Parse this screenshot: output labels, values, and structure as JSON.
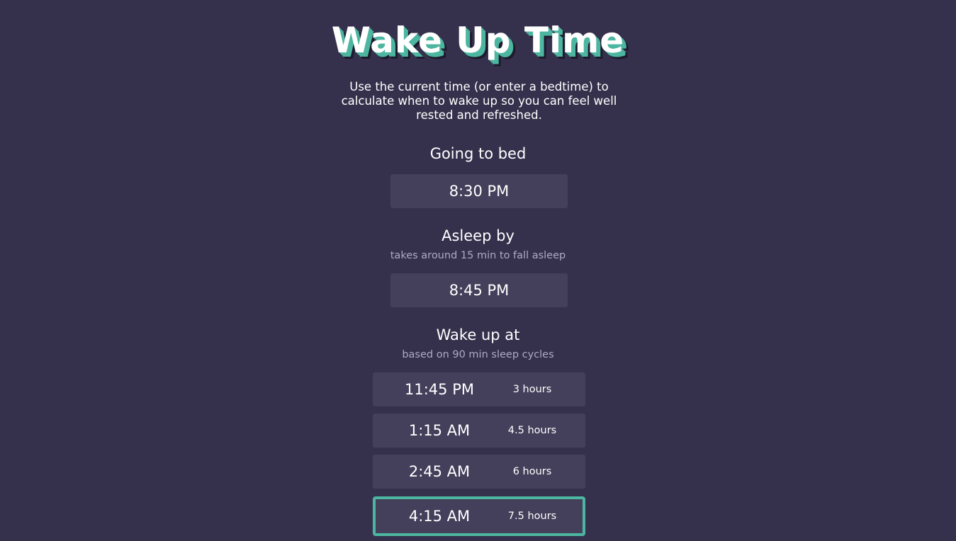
{
  "header": {
    "title": "Wake Up Time",
    "intro": "Use the current time (or enter a bedtime) to calculate when to wake up so you can feel well rested and refreshed."
  },
  "bedtime": {
    "heading": "Going to bed",
    "value": "8:30 PM"
  },
  "asleep": {
    "heading": "Asleep by",
    "subtext": "takes around 15 min to fall asleep",
    "value": "8:45 PM"
  },
  "wake": {
    "heading": "Wake up at",
    "subtext": "based on 90 min sleep cycles",
    "options": [
      {
        "time": "11:45 PM",
        "duration": "3 hours",
        "selected": false
      },
      {
        "time": "1:15 AM",
        "duration": "4.5 hours",
        "selected": false
      },
      {
        "time": "2:45 AM",
        "duration": "6 hours",
        "selected": false
      },
      {
        "time": "4:15 AM",
        "duration": "7.5 hours",
        "selected": true
      }
    ]
  },
  "colors": {
    "background": "#35314c",
    "card": "#443f5a",
    "accent": "#4db6a0",
    "muted_text": "#aeaac2"
  }
}
